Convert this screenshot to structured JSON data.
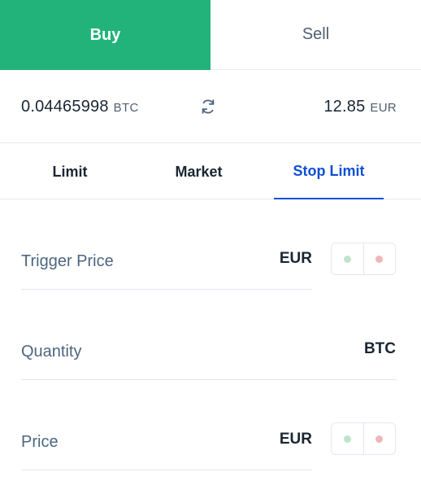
{
  "side_tabs": {
    "buy": "Buy",
    "sell": "Sell"
  },
  "balances": {
    "crypto": {
      "value": "0.04465998",
      "currency": "BTC"
    },
    "fiat": {
      "value": "12.85",
      "currency": "EUR"
    }
  },
  "order_tabs": {
    "limit": "Limit",
    "market": "Market",
    "stop_limit": "Stop Limit",
    "active": "Stop Limit"
  },
  "form": {
    "trigger_price": {
      "label": "Trigger Price",
      "unit": "EUR"
    },
    "quantity": {
      "label": "Quantity",
      "unit": "BTC"
    },
    "price": {
      "label": "Price",
      "unit": "EUR"
    }
  },
  "icons": {
    "swap": "refresh-icon"
  },
  "colors": {
    "buy": "#21b37a",
    "accent": "#0f4fd6",
    "up": "#bfe3cc",
    "down": "#eeb7b7"
  }
}
